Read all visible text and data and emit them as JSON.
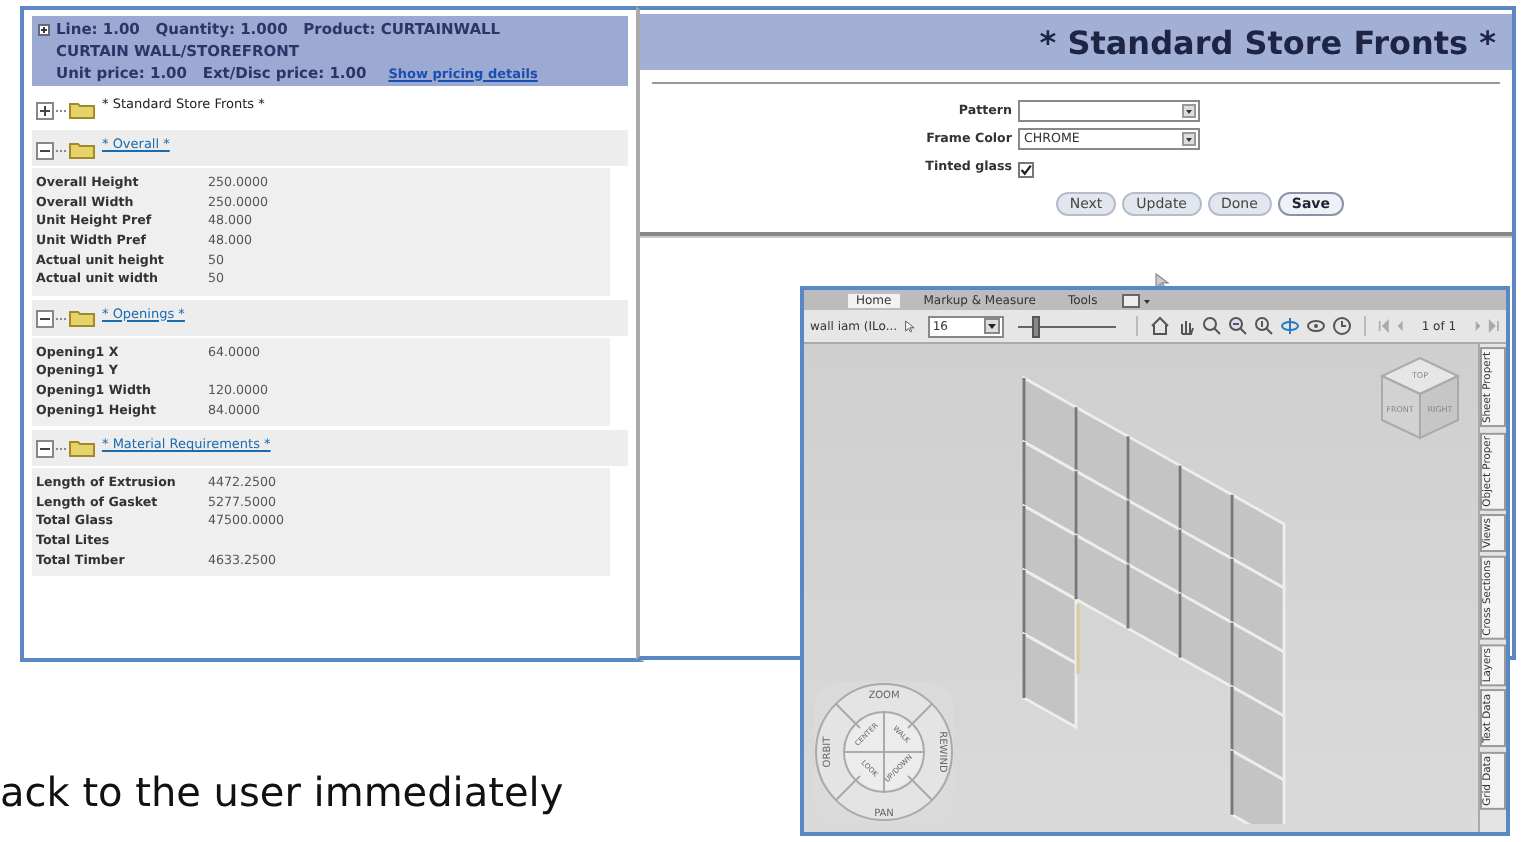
{
  "pricing_panel": {
    "header_lines": [
      "Line: 1.00   Quantity: 1.000   Product: CURTAINWALL",
      "CURTAIN WALL/STOREFRONT",
      "Unit price: 1.00   Ext/Disc price: 1.00"
    ],
    "pricing_link": "Show pricing details",
    "tree": [
      {
        "title": "* Standard Store Fronts *",
        "expanded": false
      },
      {
        "title": "* Overall *",
        "expanded": true,
        "rows": [
          {
            "label": "Overall Height",
            "value": "250.0000"
          },
          {
            "label": "Overall Width",
            "value": "250.0000"
          },
          {
            "label": "Unit Height Pref",
            "value": "48.000"
          },
          {
            "label": "Unit Width Pref",
            "value": "48.000"
          },
          {
            "label": "Actual unit height",
            "value": "50"
          },
          {
            "label": "Actual unit width",
            "value": "50"
          }
        ]
      },
      {
        "title": "* Openings *",
        "expanded": true,
        "rows": [
          {
            "label": "Opening1 X",
            "value": "64.0000"
          },
          {
            "label": "Opening1 Y"
          },
          {
            "label": "Opening1 Width",
            "value": "120.0000"
          },
          {
            "label": "Opening1 Height",
            "value": "84.0000"
          }
        ]
      },
      {
        "title": "* Material Requirements *",
        "expanded": true,
        "rows": [
          {
            "label": "Length of Extrusion",
            "value": "4472.2500"
          },
          {
            "label": "Length of Gasket",
            "value": "5277.5000"
          },
          {
            "label": "Total Glass",
            "value": "47500.0000"
          },
          {
            "label": "Total Lites"
          },
          {
            "label": "Total Timber",
            "value": "4633.2500"
          }
        ]
      }
    ]
  },
  "options_panel": {
    "title": "* Standard Store Fronts *",
    "fields": [
      {
        "kind": "select",
        "label": "Pattern"
      },
      {
        "kind": "select",
        "label": "Frame Color",
        "value": "CHROME"
      },
      {
        "kind": "checkbox",
        "label": "Tinted glass",
        "checked": true
      }
    ],
    "buttons": [
      {
        "label": "Next",
        "default": false
      },
      {
        "label": "Update",
        "default": false
      },
      {
        "label": "Done",
        "default": false
      },
      {
        "label": "Save",
        "default": true
      }
    ]
  },
  "viewer": {
    "tabs": [
      {
        "label": "Home",
        "selected": true
      },
      {
        "label": "Markup & Measure",
        "selected": false
      },
      {
        "label": "Tools",
        "selected": false
      }
    ],
    "file_label": "wall iam (ILo...",
    "scale": "16",
    "zoom_slider": {
      "level": 0.15
    },
    "page": "1 of 1",
    "view_cube": [
      "TOP",
      "FRONT",
      "RIGHT"
    ],
    "wheel": {
      "outer": [
        "ZOOM",
        "REWIND",
        "PAN",
        "ORBIT"
      ],
      "inner": [
        "CENTER",
        "WALK",
        "UP/DOWN",
        "LOOK"
      ]
    },
    "side_tabs": [
      "Sheet Propert",
      "Object Proper",
      "Views",
      "Cross Sections",
      "Layers",
      "Text Data",
      "Grid Data"
    ]
  },
  "caption": "ack to the user immediately"
}
